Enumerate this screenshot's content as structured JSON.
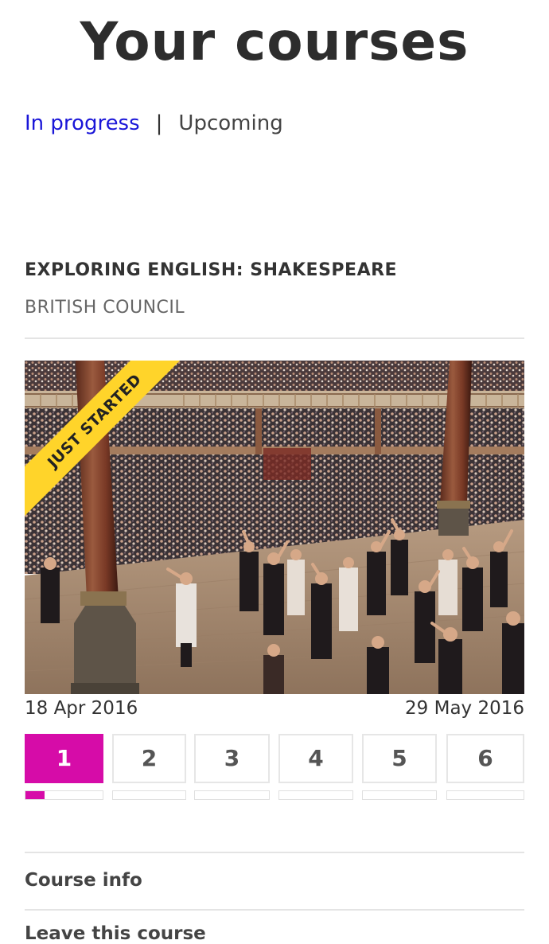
{
  "page_title": "Your courses",
  "filters": {
    "active": "In progress",
    "separator": "|",
    "inactive": "Upcoming"
  },
  "course": {
    "title": "EXPLORING ENGLISH: SHAKESPEARE",
    "provider": "BRITISH COUNCIL",
    "badge": "JUST STARTED",
    "image": "theatre-performance-photo",
    "start_date": "18 Apr 2016",
    "end_date": "29 May 2016",
    "weeks": [
      {
        "label": "1",
        "progress": 0.25,
        "active": true
      },
      {
        "label": "2",
        "progress": 0,
        "active": false
      },
      {
        "label": "3",
        "progress": 0,
        "active": false
      },
      {
        "label": "4",
        "progress": 0,
        "active": false
      },
      {
        "label": "5",
        "progress": 0,
        "active": false
      },
      {
        "label": "6",
        "progress": 0,
        "active": false
      }
    ]
  },
  "menu": {
    "course_info": "Course info",
    "leave_course": "Leave this course"
  },
  "colors": {
    "accent": "#d60ca8",
    "link": "#1a16d8",
    "badge": "#ffd42a"
  }
}
